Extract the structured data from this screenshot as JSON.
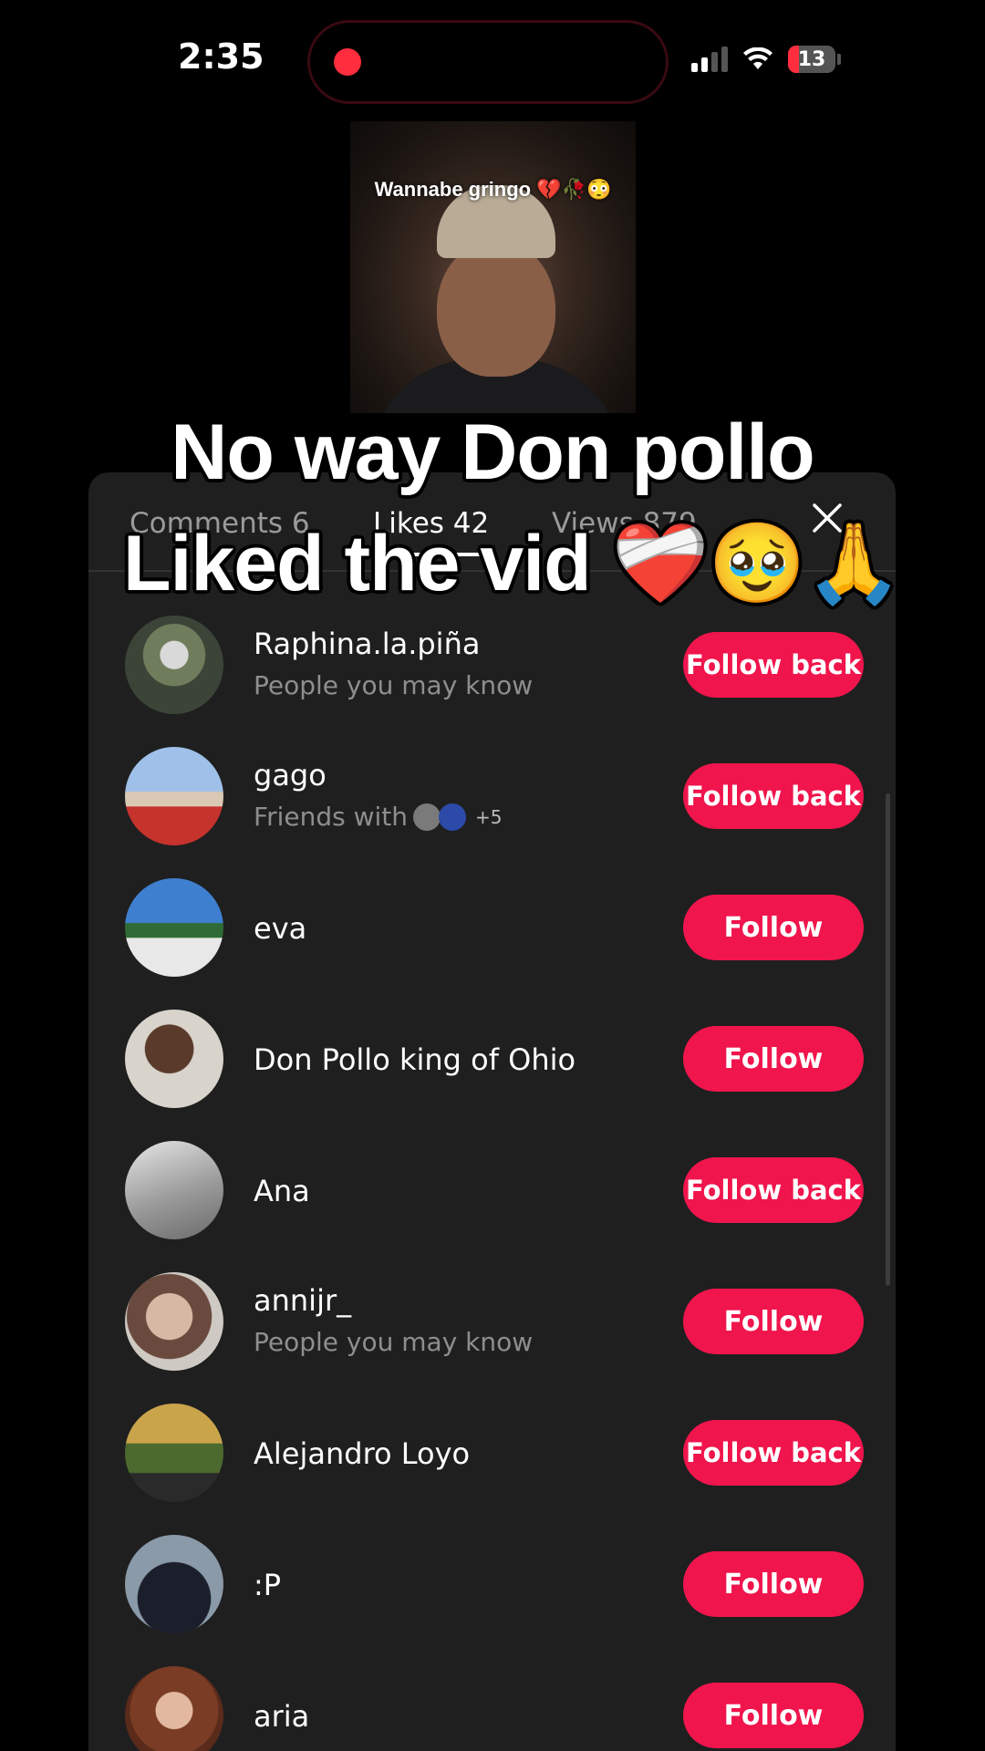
{
  "status": {
    "time": "2:35",
    "battery": "13"
  },
  "video": {
    "caption": "Wannabe gringo 💔🥀😳"
  },
  "overlay": {
    "line1": "No way Don pollo",
    "line2": "Liked the vid ❤️‍🩹🥹🙏"
  },
  "tabs": {
    "comments": "Comments 6",
    "likes": "Likes 42",
    "views": "Views 879"
  },
  "users": [
    {
      "name": "Raphina.la.piña",
      "sub": "People you may know",
      "button": "Follow back"
    },
    {
      "name": "gago",
      "sub": "Friends with",
      "sub_extra": "+5",
      "button": "Follow back"
    },
    {
      "name": "eva",
      "button": "Follow"
    },
    {
      "name": "Don Pollo king of Ohio",
      "button": "Follow"
    },
    {
      "name": "Ana",
      "button": "Follow back"
    },
    {
      "name": "annijr_",
      "sub": "People you may know",
      "button": "Follow"
    },
    {
      "name": "Alejandro Loyo",
      "button": "Follow back"
    },
    {
      "name": ":P",
      "button": "Follow"
    },
    {
      "name": "aria",
      "button": "Follow"
    }
  ],
  "colors": {
    "accent": "#f0154c",
    "sheet": "#1f1f20",
    "recording": "#ff2d3d"
  }
}
